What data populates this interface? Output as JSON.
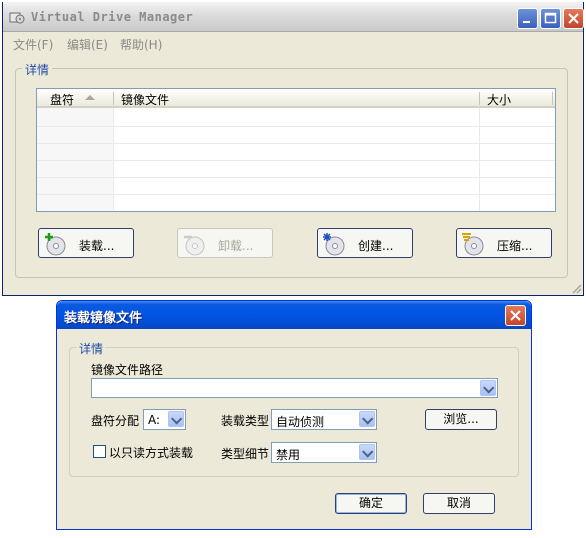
{
  "main_window": {
    "title": "Virtual Drive Manager",
    "menu": [
      "文件(F)",
      "编辑(E)",
      "帮助(H)"
    ],
    "group_label": "详情",
    "table": {
      "columns": [
        "盘符",
        "镜像文件",
        "大小"
      ]
    },
    "buttons": {
      "mount": "装载...",
      "unmount": "卸载...",
      "create": "创建...",
      "compress": "压缩..."
    }
  },
  "dialog": {
    "title": "装载镜像文件",
    "group_label": "详情",
    "image_path_label": "镜像文件路径",
    "image_path_value": "",
    "drive_assign_label": "盘符分配",
    "drive_assign_value": "A:",
    "mount_type_label": "装载类型",
    "mount_type_value": "自动侦测",
    "browse": "浏览...",
    "readonly_label": "以只读方式装载",
    "readonly_checked": false,
    "type_detail_label": "类型细节",
    "type_detail_value": "禁用",
    "ok": "确定",
    "cancel": "取消"
  },
  "colors": {
    "window_face": "#ece9d8",
    "group_label": "#1e4ca8",
    "dialog_title_bar": "#0054e3",
    "close_button": "#c2452a"
  }
}
